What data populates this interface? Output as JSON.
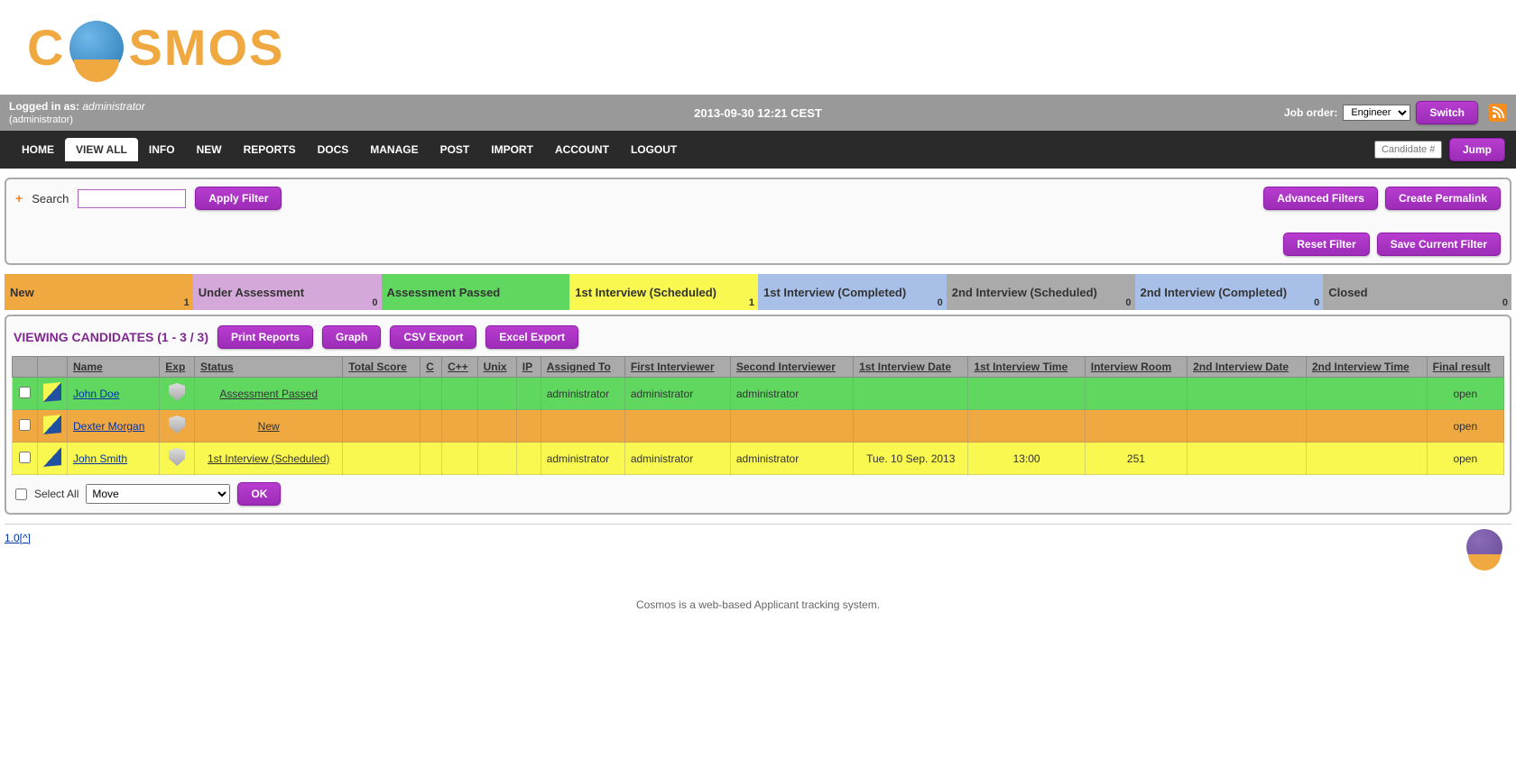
{
  "status_bar": {
    "logged_in_label": "Logged in as:",
    "username": "administrator",
    "role": "(administrator)",
    "datetime": "2013-09-30 12:21 CEST",
    "job_order_label": "Job order:",
    "job_order_selected": "Engineer",
    "switch_label": "Switch"
  },
  "nav": {
    "items": [
      "HOME",
      "VIEW ALL",
      "INFO",
      "NEW",
      "REPORTS",
      "DOCS",
      "MANAGE",
      "POST",
      "IMPORT",
      "ACCOUNT",
      "LOGOUT"
    ],
    "active_index": 1,
    "candidate_placeholder": "Candidate #",
    "jump_label": "Jump"
  },
  "search": {
    "label": "Search",
    "apply_filter": "Apply Filter",
    "advanced_filters": "Advanced Filters",
    "create_permalink": "Create Permalink",
    "reset_filter": "Reset Filter",
    "save_current_filter": "Save Current Filter"
  },
  "pipeline": [
    {
      "name": "New",
      "count": "1",
      "class": "stage-new"
    },
    {
      "name": "Under Assessment",
      "count": "0",
      "class": "stage-under"
    },
    {
      "name": "Assessment Passed",
      "count": "",
      "class": "stage-passed"
    },
    {
      "name": "1st Interview (Scheduled)",
      "count": "1",
      "class": "stage-1sched"
    },
    {
      "name": "1st Interview (Completed)",
      "count": "0",
      "class": "stage-1comp"
    },
    {
      "name": "2nd Interview (Scheduled)",
      "count": "0",
      "class": "stage-2sched"
    },
    {
      "name": "2nd Interview (Completed)",
      "count": "0",
      "class": "stage-2comp"
    },
    {
      "name": "Closed",
      "count": "0",
      "class": "stage-closed"
    }
  ],
  "viewing": {
    "label": "VIEWING CANDIDATES (1 - 3 / 3)",
    "print_reports": "Print Reports",
    "graph": "Graph",
    "csv_export": "CSV Export",
    "excel_export": "Excel Export"
  },
  "columns": [
    "",
    "",
    "Name",
    "Exp",
    "Status",
    "Total Score",
    "C",
    "C++",
    "Unix",
    "IP",
    "Assigned To",
    "First Interviewer",
    "Second Interviewer",
    "1st Interview Date",
    "1st Interview Time",
    "Interview Room",
    "2nd Interview Date",
    "2nd Interview Time",
    "Final result"
  ],
  "rows": [
    {
      "row_class": "row-green",
      "name": "John Doe",
      "status": "Assessment Passed",
      "assigned": "administrator",
      "first_int": "administrator",
      "second_int": "administrator",
      "d1": "",
      "t1": "",
      "room": "",
      "d2": "",
      "t2": "",
      "final": "open"
    },
    {
      "row_class": "row-orange",
      "name": "Dexter Morgan",
      "status": "New",
      "assigned": "",
      "first_int": "",
      "second_int": "",
      "d1": "",
      "t1": "",
      "room": "",
      "d2": "",
      "t2": "",
      "final": "open"
    },
    {
      "row_class": "row-yellow",
      "name": "John Smith",
      "status": "1st Interview (Scheduled)",
      "assigned": "administrator",
      "first_int": "administrator",
      "second_int": "administrator",
      "d1": "Tue. 10 Sep. 2013",
      "t1": "13:00",
      "room": "251",
      "d2": "",
      "t2": "",
      "final": "open"
    }
  ],
  "table_footer": {
    "select_all": "Select All",
    "action_selected": "Move",
    "ok": "OK"
  },
  "footer": {
    "version": "1.0[^]",
    "tagline": "Cosmos is a web-based Applicant tracking system."
  }
}
